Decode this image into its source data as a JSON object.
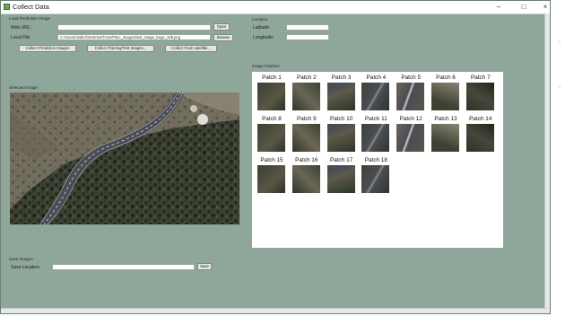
{
  "window": {
    "title": "Collect Data",
    "minimize": "–",
    "maximize": "□",
    "close": "×"
  },
  "load_section": {
    "title": "Load Prediction Image",
    "web_url_label": "Web URL:",
    "web_url_value": "",
    "open_button": "Open",
    "local_file_label": "Local File",
    "local_file_value": "C:/Users/nsdin/OneDrive/Tcms/Fbsc_images/test_image_large_108.png",
    "browse_button": "Browse",
    "collect_prediction_button": "Collect Prediction Images",
    "collect_training_button": "Collect Training/Test Images...",
    "collect_satellite_button": "Collect From satellite..."
  },
  "location_section": {
    "title": "Location",
    "latitude_label": "Latitude:",
    "latitude_value": "",
    "longitude_label": "Longitude:",
    "longitude_value": ""
  },
  "selected_image_section": {
    "title": "Selected Image"
  },
  "patches_section": {
    "title": "Image Patches",
    "patches": [
      {
        "label": "Patch 1"
      },
      {
        "label": "Patch 2"
      },
      {
        "label": "Patch 3"
      },
      {
        "label": "Patch 4"
      },
      {
        "label": "Patch 5"
      },
      {
        "label": "Patch 6"
      },
      {
        "label": "Patch 7"
      },
      {
        "label": "Patch 8"
      },
      {
        "label": "Patch 9"
      },
      {
        "label": "Patch 10"
      },
      {
        "label": "Patch 11"
      },
      {
        "label": "Patch 12"
      },
      {
        "label": "Patch 13"
      },
      {
        "label": "Patch 14"
      },
      {
        "label": "Patch 15"
      },
      {
        "label": "Patch 16"
      },
      {
        "label": "Patch 17"
      },
      {
        "label": "Patch 18"
      }
    ]
  },
  "save_section": {
    "title": "Save Images",
    "save_location_label": "Save Location:",
    "save_location_value": "",
    "save_button": "Save"
  },
  "colors": {
    "window_bg": "#8fa79a",
    "panel_bg": "#ffffff",
    "road": "#4a4d55",
    "terrain": "#6f6a5c",
    "vegetation": "#2c3526"
  }
}
